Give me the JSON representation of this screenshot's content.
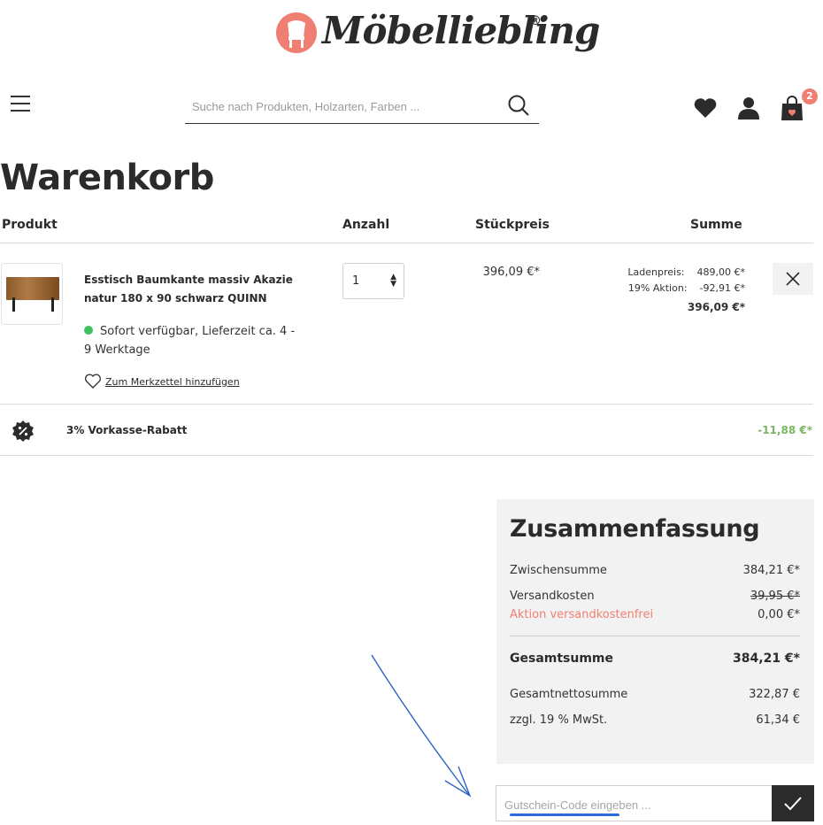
{
  "brand": {
    "name": "Möbelliebling",
    "reg": "®",
    "accent": "#ef7f72"
  },
  "header": {
    "search_placeholder": "Suche nach Produkten, Holzarten, Farben ...",
    "cart_count": "2"
  },
  "cart": {
    "title": "Warenkorb",
    "columns": {
      "product": "Produkt",
      "qty": "Anzahl",
      "unit_price": "Stückpreis",
      "sum": "Summe"
    },
    "items": [
      {
        "name": "Esstisch Baumkante massiv Akazie natur 180 x 90 schwarz QUINN",
        "availability": "Sofort verfügbar, Lieferzeit ca. 4 - 9 Werktage",
        "wishlist_label": "Zum Merkzettel hinzufügen",
        "quantity": "1",
        "unit_price": "396,09 €*",
        "store_price_label": "Ladenpreis:",
        "store_price": "489,00 €*",
        "promo_label": "19% Aktion:",
        "promo_value": "-92,91 €*",
        "total": "396,09 €*"
      }
    ],
    "discount": {
      "label": "3% Vorkasse-Rabatt",
      "value": "-11,88 €*",
      "color": "#7bb661"
    }
  },
  "summary": {
    "title": "Zusammenfassung",
    "subtotal_label": "Zwischensumme",
    "subtotal": "384,21 €*",
    "shipping_label": "Versandkosten",
    "shipping": "39,95 €*",
    "shipping_promo_label": "Aktion versandkostenfrei",
    "shipping_promo": "0,00 €*",
    "total_label": "Gesamtsumme",
    "total": "384,21 €*",
    "net_label": "Gesamtnettosumme",
    "net": "322,87 €",
    "vat_label": "zzgl. 19 % MwSt.",
    "vat": "61,34 €"
  },
  "voucher": {
    "placeholder": "Gutschein-Code eingeben ..."
  },
  "icons": [
    "menu-icon",
    "search-icon",
    "heart-icon",
    "user-icon",
    "cart-icon",
    "close-icon",
    "percent-badge-icon",
    "check-icon",
    "heart-outline-icon"
  ]
}
